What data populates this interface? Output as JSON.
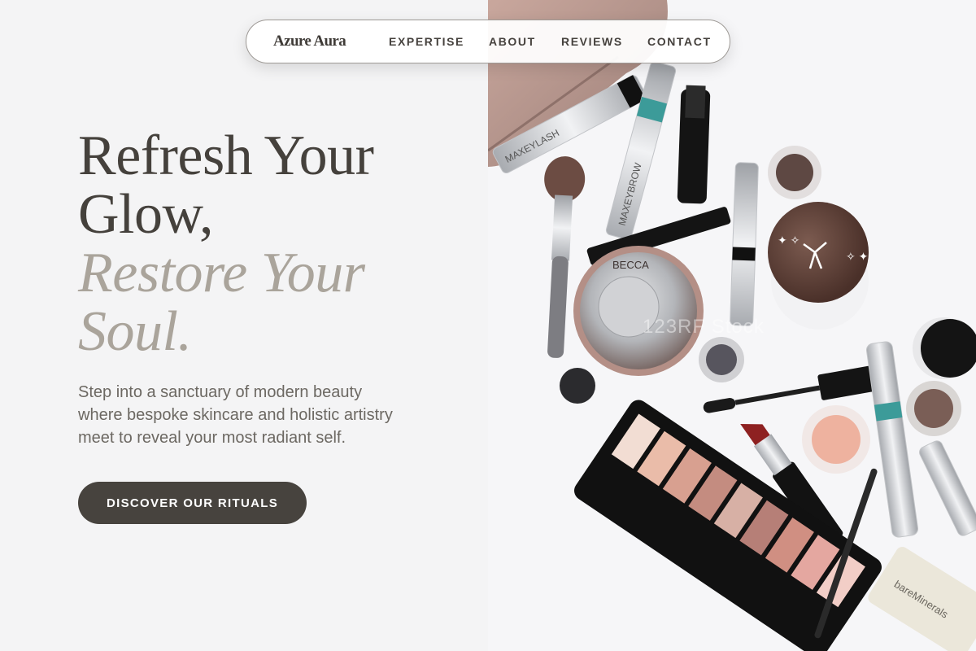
{
  "brand": {
    "name": "Azure Aura"
  },
  "nav": {
    "items": [
      "EXPERTISE",
      "ABOUT",
      "REVIEWS",
      "CONTACT"
    ]
  },
  "hero": {
    "headline_line1": "Refresh Your Glow,",
    "headline_line2": "Restore Your Soul.",
    "subtitle": "Step into a sanctuary of modern beauty where bespoke skincare and holistic artistry meet to reveal your most radiant self.",
    "cta_label": "DISCOVER OUR RITUALS"
  },
  "photo": {
    "watermark": "123RF Stock",
    "product_labels": {
      "lash": "MAXEYLASH",
      "brow": "MAXEYBROW",
      "powder": "bareMinerals",
      "compact": "BECCA"
    }
  },
  "colors": {
    "dark": "#45413c",
    "accent_muted": "#aaa49b",
    "button_bg": "#47433e",
    "teal_band": "#3c9b99"
  }
}
